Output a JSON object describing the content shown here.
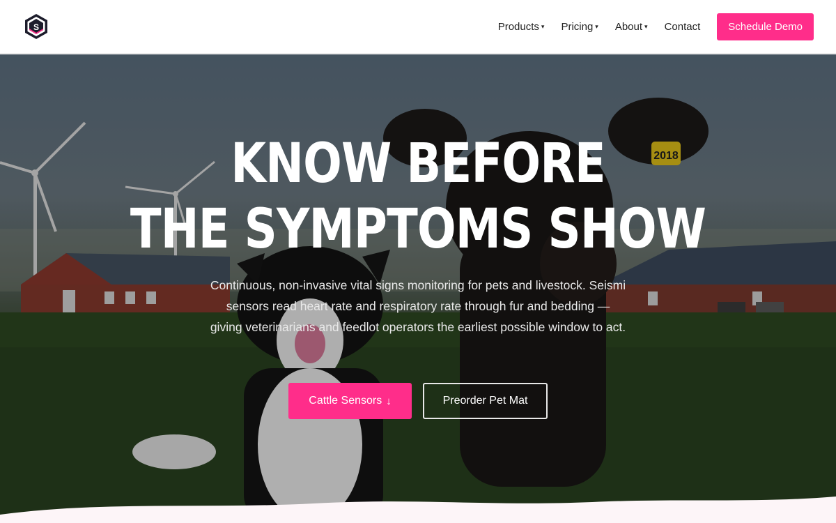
{
  "brand": {
    "logo_letter": "S",
    "accent_color": "#ff2d8a"
  },
  "nav": {
    "items": [
      {
        "label": "Products",
        "has_dropdown": true
      },
      {
        "label": "Pricing",
        "has_dropdown": true
      },
      {
        "label": "About",
        "has_dropdown": true
      },
      {
        "label": "Contact",
        "has_dropdown": false
      }
    ],
    "caret": "▾",
    "cta_label": "Schedule Demo"
  },
  "hero": {
    "title_line1": "KNOW BEFORE",
    "title_line2": "THE SYMPTOMS SHOW",
    "subtitle": "Continuous, non-invasive vital signs monitoring for pets and livestock. Seismi sensors read heart rate and respiratory rate through fur and bedding — giving veterinarians and feedlot operators the earliest possible window to act.",
    "ear_tag": "2018",
    "primary_button": {
      "label": "Cattle Sensors",
      "icon": "↓"
    },
    "secondary_button": {
      "label": "Preorder Pet Mat"
    }
  }
}
